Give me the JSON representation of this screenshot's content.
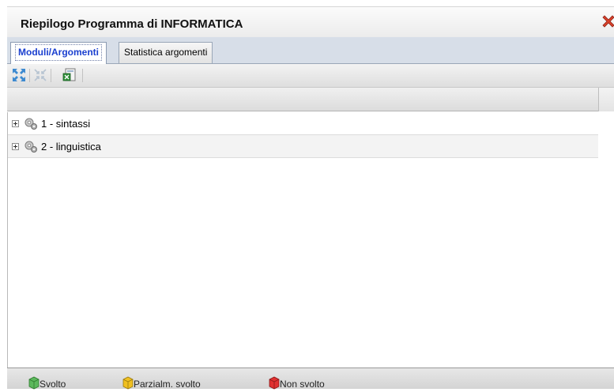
{
  "dialog": {
    "title": "Riepilogo Programma di INFORMATICA",
    "close_icon": "close-x-icon"
  },
  "tabs": [
    {
      "label": "Moduli/Argomenti",
      "active": true
    },
    {
      "label": "Statistica argomenti",
      "active": false
    }
  ],
  "toolbar": {
    "buttons": [
      {
        "icon": "expand-all-icon",
        "enabled": true
      },
      {
        "icon": "collapse-all-icon",
        "enabled": false
      },
      {
        "icon": "export-excel-icon",
        "enabled": true
      }
    ]
  },
  "tree": {
    "items": [
      {
        "label": "1 - sintassi",
        "icon": "module-gears-icon",
        "expanded": false
      },
      {
        "label": "2 - linguistica",
        "icon": "module-gears-icon",
        "expanded": false
      }
    ]
  },
  "legend": [
    {
      "label": "Svolto",
      "icon": "cube-green-icon",
      "color": "#5cb85c"
    },
    {
      "label": "Parzialm. svolto",
      "icon": "cube-yellow-icon",
      "color": "#f0c020"
    },
    {
      "label": "Non svolto",
      "icon": "cube-red-icon",
      "color": "#e03030"
    }
  ],
  "colors": {
    "active_tab_text": "#1a3fcf",
    "close_icon": "#d9412b"
  }
}
